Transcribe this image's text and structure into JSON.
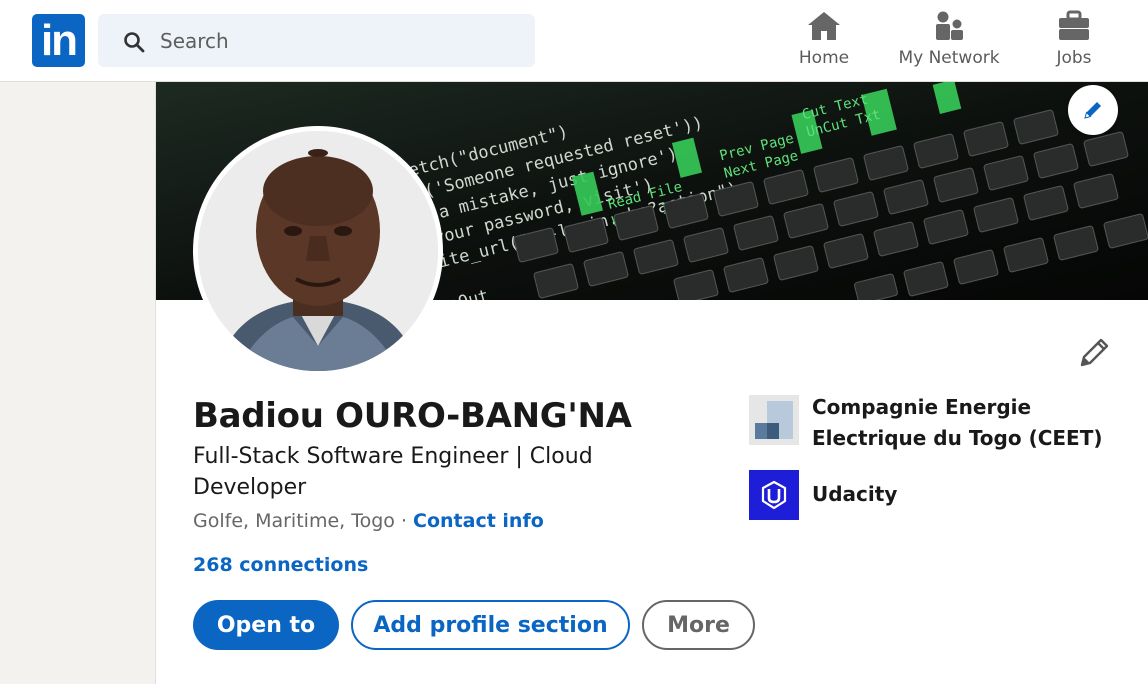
{
  "nav": {
    "logo_text": "in",
    "search_placeholder": "Search",
    "items": [
      {
        "label": "Home",
        "icon": "home-icon"
      },
      {
        "label": "My Network",
        "icon": "network-icon"
      },
      {
        "label": "Jobs",
        "icon": "briefcase-icon"
      }
    ]
  },
  "profile": {
    "name": "Badiou OURO-BANG'NA",
    "headline": "Full-Stack Software Engineer | Cloud Developer",
    "location": "Golfe, Maritime, Togo",
    "separator": " · ",
    "contact_info": "Contact info",
    "connections": "268 connections"
  },
  "actions": {
    "open_to": "Open to",
    "add_section": "Add profile section",
    "more": "More"
  },
  "experience": [
    {
      "name": "Compagnie Energie Electrique du Togo (CEET)",
      "logo": "ceet-logo"
    },
    {
      "name": "Udacity",
      "logo": "udacity-logo"
    }
  ],
  "colors": {
    "brand": "#0a66c2",
    "search_bg": "#edf3f8",
    "page_bg": "#f4f2ee",
    "udacity": "#1e1ed8"
  }
}
